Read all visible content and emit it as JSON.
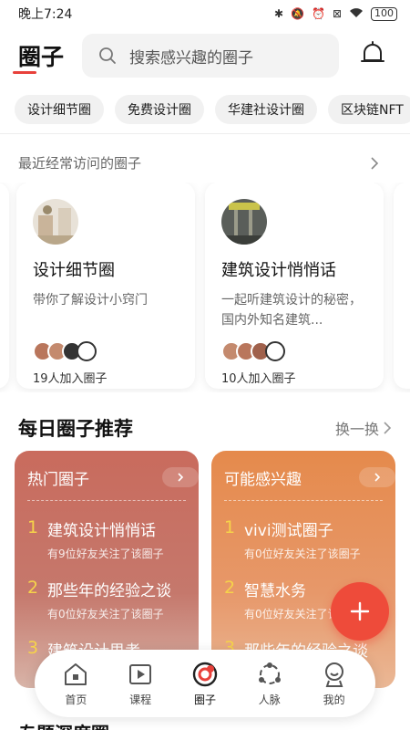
{
  "status": {
    "time": "晚上7:24",
    "battery": "100"
  },
  "header": {
    "title": "圈子",
    "search_placeholder": "搜索感兴趣的圈子"
  },
  "chips": [
    "设计细节圈",
    "免费设计圈",
    "华建社设计圈",
    "区块链NFT"
  ],
  "recent": {
    "heading": "最近经常访问的圈子",
    "cards": [
      {
        "name": "设计细节圈",
        "desc": "带你了解设计小窍门",
        "count": "19人加入圈子"
      },
      {
        "name": "建筑设计悄悄话",
        "desc": "一起听建筑设计的秘密，国内外知名建筑...",
        "count": "10人加入圈子"
      }
    ]
  },
  "daily": {
    "title": "每日圈子推荐",
    "refresh": "换一换",
    "hot": {
      "name": "热门圈子",
      "items": [
        {
          "rank": "1",
          "name": "建筑设计悄悄话",
          "sub": "有9位好友关注了该圈子"
        },
        {
          "rank": "2",
          "name": "那些年的经验之谈",
          "sub": "有0位好友关注了该圈子"
        },
        {
          "rank": "3",
          "name": "建筑设计思考",
          "sub": ""
        }
      ]
    },
    "interest": {
      "name": "可能感兴趣",
      "items": [
        {
          "rank": "1",
          "name": "vivi测试圈子",
          "sub": "有0位好友关注了该圈子"
        },
        {
          "rank": "2",
          "name": "智慧水务",
          "sub": "有0位好友关注了该圈子"
        },
        {
          "rank": "3",
          "name": "那些年的经验之谈",
          "sub": ""
        }
      ]
    }
  },
  "nav": {
    "home": "首页",
    "course": "课程",
    "circle": "圈子",
    "network": "人脉",
    "mine": "我的"
  },
  "colors": {
    "accent": "#e8413b",
    "fab": "#ee4b3a",
    "rank": "#f6d34a"
  },
  "peek": {
    "title": "专题深度圈"
  }
}
